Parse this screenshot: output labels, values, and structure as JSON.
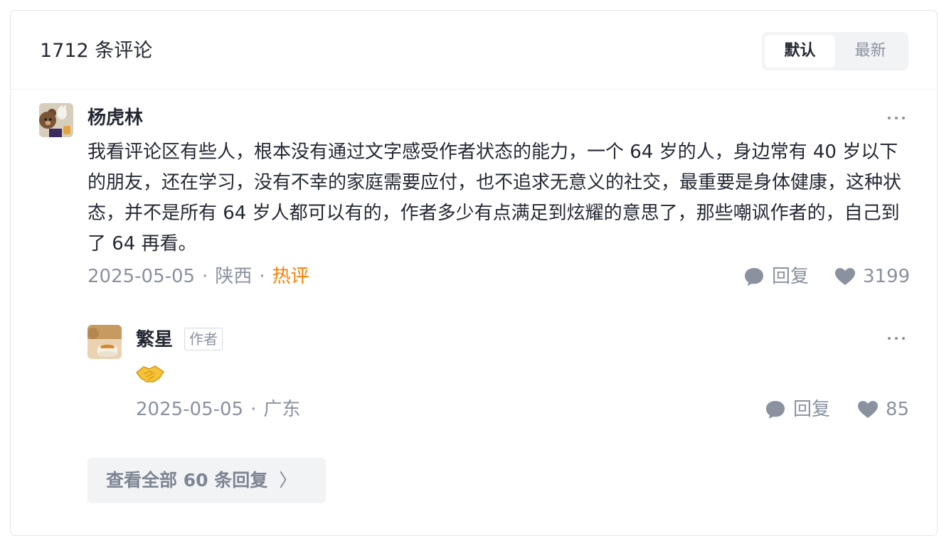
{
  "header": {
    "comment_count": "1712 条评论",
    "sort_options": [
      {
        "label": "默认",
        "active": true
      },
      {
        "label": "最新",
        "active": false
      }
    ]
  },
  "comment": {
    "author": "杨虎林",
    "text": "我看评论区有些人，根本没有通过文字感受作者状态的能力，一个 64 岁的人，身边常有 40 岁以下的朋友，还在学习，没有不幸的家庭需要应付，也不追求无意义的社交，最重要是身体健康，这种状态，并不是所有 64 岁人都可以有的，作者多少有点满足到炫耀的意思了，那些嘲讽作者的，自己到了 64 再看。",
    "date": "2025-05-05",
    "location": "陕西",
    "separator": "·",
    "hot_badge": "热评",
    "reply_label": "回复",
    "likes": "3199"
  },
  "reply": {
    "author": "繁星",
    "author_badge": "作者",
    "emoji": "handshake-emoji",
    "date": "2025-05-05",
    "location": "广东",
    "separator": "·",
    "reply_label": "回复",
    "likes": "85"
  },
  "view_all": {
    "label": "查看全部 60 条回复",
    "chevron": "〉"
  },
  "colors": {
    "text_primary": "#252933",
    "text_secondary": "#8a919f",
    "hot": "#ff7d00",
    "toggle_bg": "#f2f3f5",
    "border": "#e4e6eb"
  }
}
